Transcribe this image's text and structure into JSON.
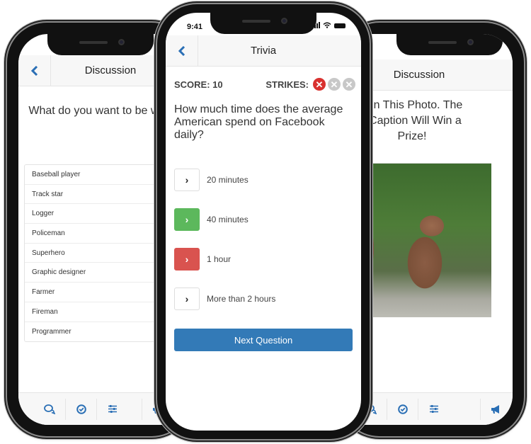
{
  "left_phone": {
    "nav": {
      "title": "Discussion",
      "back_icon": "chevron-left-icon"
    },
    "question": "What do you want to be when you grow up?",
    "options": [
      "Baseball player",
      "Track star",
      "Logger",
      "Policeman",
      "Superhero",
      "Graphic designer",
      "Farmer",
      "Fireman",
      "Programmer"
    ],
    "tabbar": {
      "items": [
        {
          "icon": "chat-bubbles-icon",
          "glyph": "🗨"
        },
        {
          "icon": "check-circle-icon",
          "glyph": "✓"
        },
        {
          "icon": "sliders-icon",
          "glyph": "☰"
        },
        {
          "icon": "megaphone-icon",
          "glyph": "📢"
        }
      ]
    }
  },
  "middle_phone": {
    "status": {
      "time": "9:41"
    },
    "nav": {
      "title": "Trivia",
      "back_icon": "chevron-left-icon"
    },
    "score_label": "SCORE: 10",
    "strikes_label": "STRIKES:",
    "strikes": [
      {
        "state": "used",
        "glyph": "✕",
        "color": "#d9312f"
      },
      {
        "state": "unused",
        "glyph": "✕",
        "color": "#c8c8c8"
      },
      {
        "state": "unused",
        "glyph": "✕",
        "color": "#c8c8c8"
      }
    ],
    "question": "How much time does the average American spend on Facebook daily?",
    "answers": [
      {
        "label": "20 minutes",
        "state": "default",
        "glyph": "›"
      },
      {
        "label": "40 minutes",
        "state": "correct",
        "glyph": "›"
      },
      {
        "label": "1 hour",
        "state": "wrong",
        "glyph": "›"
      },
      {
        "label": "More than 2 hours",
        "state": "default",
        "glyph": "›"
      }
    ],
    "next_button": "Next Question",
    "colors": {
      "primary": "#337ab7",
      "correct": "#5cb85c",
      "wrong": "#d9534f",
      "accent": "#2a6fb5"
    }
  },
  "right_phone": {
    "nav": {
      "title": "Discussion"
    },
    "question": "Caption This Photo. The Best Caption Will Win a Prize!",
    "question_visible": "tion This Photo. The\nt Caption Will Win a\nPrize!",
    "photo_alt": "Two bear cubs playing",
    "tabbar": {
      "items": [
        {
          "icon": "chat-bubbles-icon",
          "glyph": "🗨"
        },
        {
          "icon": "check-circle-icon",
          "glyph": "✓"
        },
        {
          "icon": "sliders-icon",
          "glyph": "☰"
        },
        {
          "icon": "megaphone-icon",
          "glyph": "📢"
        }
      ]
    }
  }
}
